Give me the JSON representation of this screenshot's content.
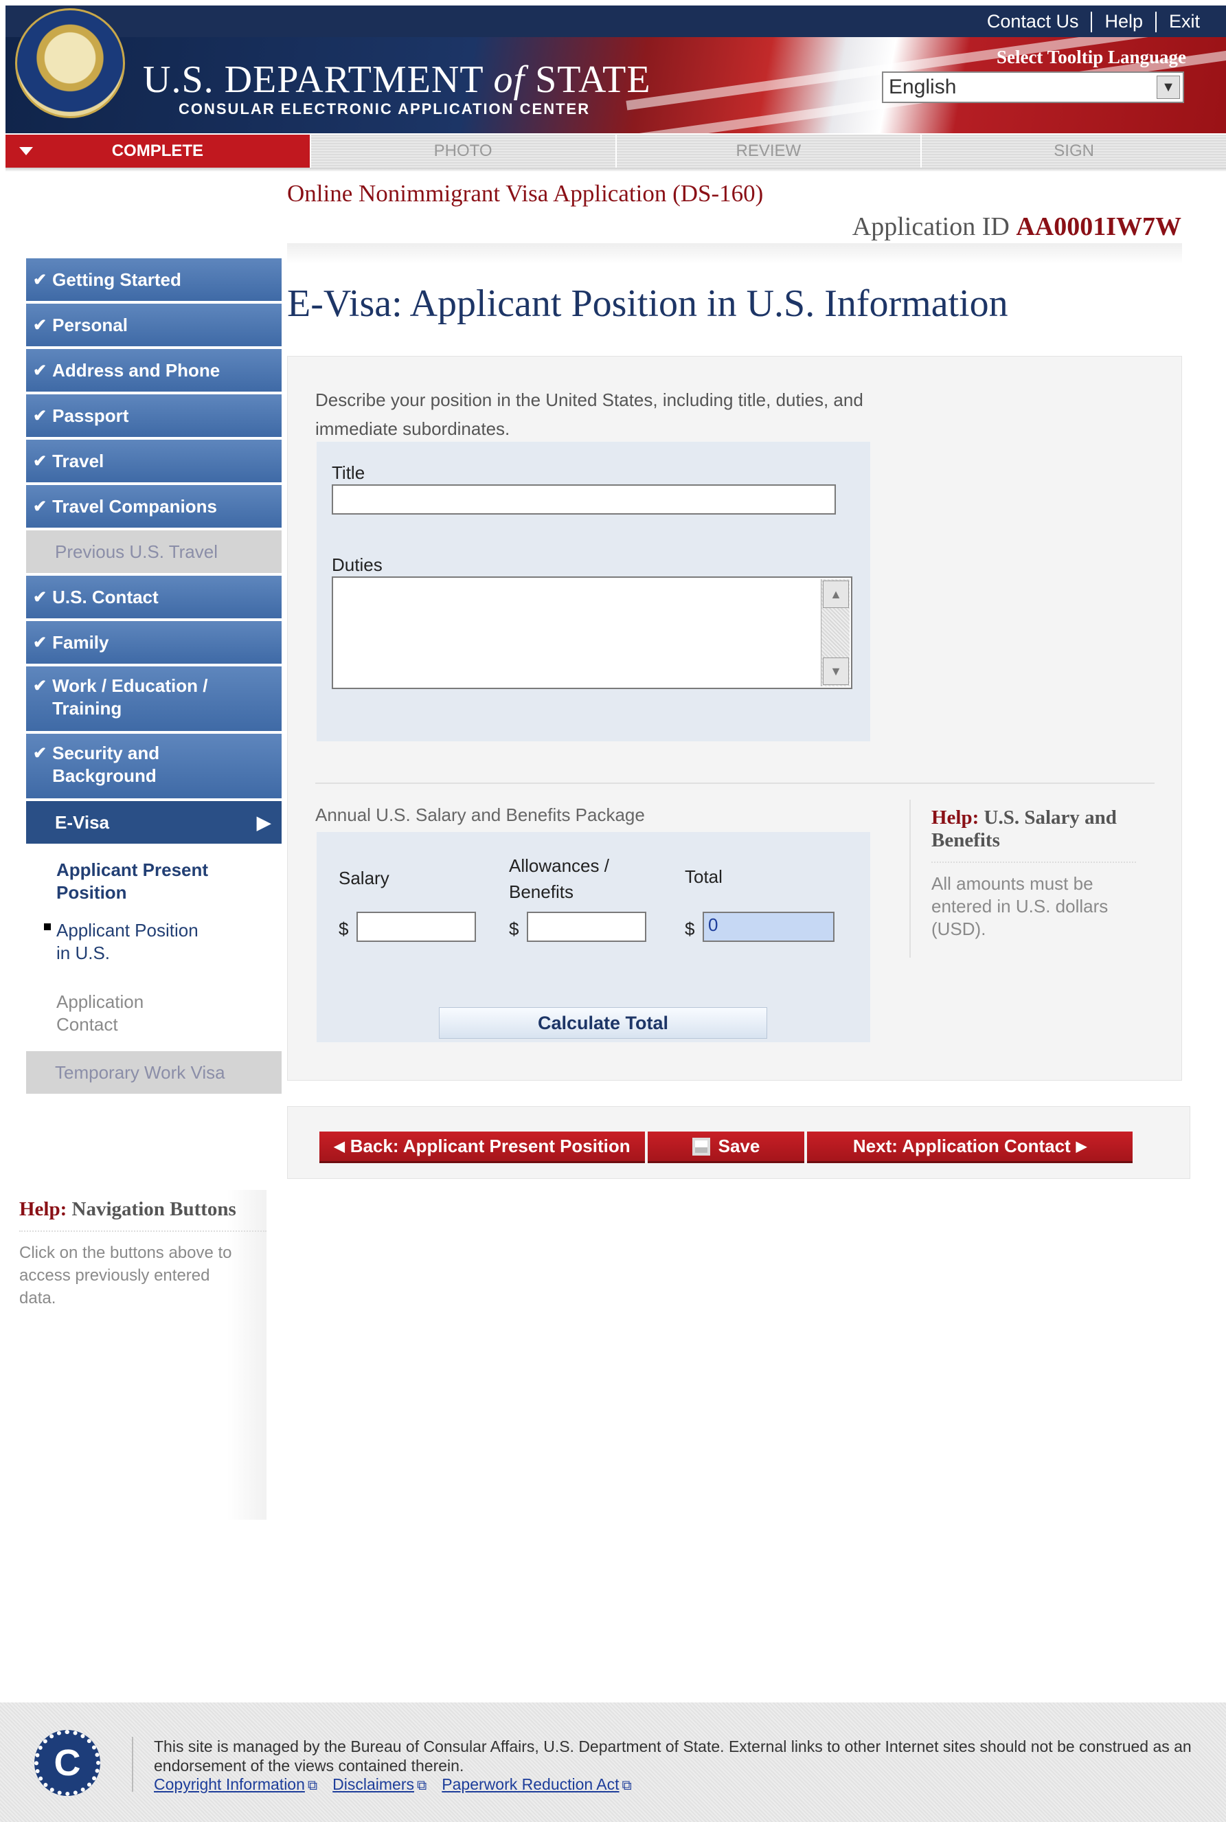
{
  "header": {
    "top_links": [
      "Contact Us",
      "Help",
      "Exit"
    ],
    "dept_title_1": "U.S. DEPARTMENT",
    "dept_title_of": "of",
    "dept_title_2": "STATE",
    "dept_subtitle": "CONSULAR ELECTRONIC APPLICATION CENTER",
    "tooltip_language_label": "Select Tooltip Language",
    "language_value": "English"
  },
  "progress_tabs": [
    {
      "label": "COMPLETE",
      "active": true
    },
    {
      "label": "PHOTO",
      "active": false
    },
    {
      "label": "REVIEW",
      "active": false
    },
    {
      "label": "SIGN",
      "active": false
    }
  ],
  "form_title": "Online Nonimmigrant Visa Application (DS-160)",
  "application_id": {
    "label": "Application ID",
    "value": "AA0001IW7W"
  },
  "sidebar": {
    "items": [
      {
        "label": "Getting Started",
        "state": "done"
      },
      {
        "label": "Personal",
        "state": "done"
      },
      {
        "label": "Address and Phone",
        "state": "done"
      },
      {
        "label": "Passport",
        "state": "done"
      },
      {
        "label": "Travel",
        "state": "done"
      },
      {
        "label": "Travel Companions",
        "state": "done"
      },
      {
        "label": "Previous U.S. Travel",
        "state": "disabled"
      },
      {
        "label": "U.S. Contact",
        "state": "done"
      },
      {
        "label": "Family",
        "state": "done"
      },
      {
        "label": "Work / Education / Training",
        "state": "done"
      },
      {
        "label": "Security and Background",
        "state": "done"
      },
      {
        "label": "E-Visa",
        "state": "current"
      }
    ],
    "sub_items": [
      {
        "label": "Applicant Present Position",
        "state": "link"
      },
      {
        "label": "Applicant Position in U.S.",
        "state": "current"
      },
      {
        "label": "Application Contact",
        "state": "disabled"
      }
    ],
    "after_item": "Temporary Work Visa"
  },
  "page_heading": "E-Visa: Applicant Position in U.S. Information",
  "position_section": {
    "description": "Describe your position in the United States, including title, duties, and immediate subordinates.",
    "title_label": "Title",
    "title_value": "",
    "duties_label": "Duties",
    "duties_value": ""
  },
  "salary_section": {
    "heading": "Annual U.S. Salary and Benefits Package",
    "salary_label": "Salary",
    "allowances_label": "Allowances / Benefits",
    "total_label": "Total",
    "currency_symbol": "$",
    "salary_value": "",
    "allowances_value": "",
    "total_value": "0",
    "calculate_button": "Calculate Total"
  },
  "help_salary": {
    "title_prefix": "Help:",
    "title": "U.S. Salary and Benefits",
    "body": "All amounts must be entered in U.S. dollars (USD)."
  },
  "nav_buttons": {
    "back": "Back: Applicant Present Position",
    "save": "Save",
    "next": "Next: Application Contact"
  },
  "help_nav": {
    "title_prefix": "Help:",
    "title": "Navigation Buttons",
    "body": "Click on the buttons above to access previously entered data."
  },
  "footer": {
    "logo_letter": "C",
    "text": "This site is managed by the Bureau of Consular Affairs, U.S. Department of State. External links to other Internet sites should not be construed as an endorsement of the views contained therein.",
    "links": [
      "Copyright Information",
      "Disclaimers",
      "Paperwork Reduction Act"
    ]
  },
  "colors": {
    "navy": "#1b2f57",
    "brand_red": "#c1181f",
    "nav_blue": "#3f6aa6",
    "dark_red_text": "#8a1016"
  }
}
